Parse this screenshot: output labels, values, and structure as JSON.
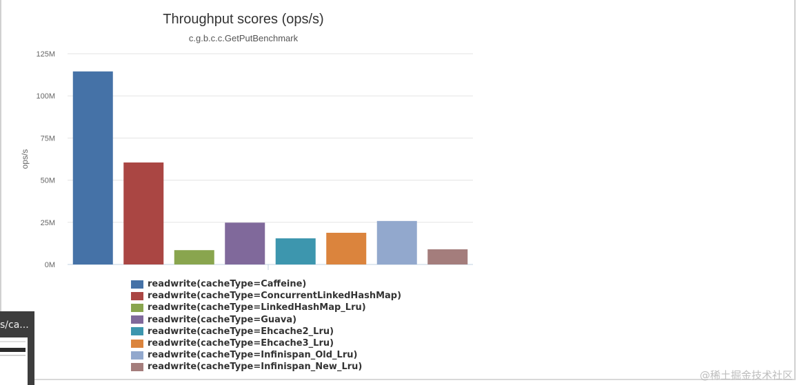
{
  "chart_data": {
    "type": "bar",
    "title": "Throughput scores (ops/s)",
    "subtitle": "c.g.b.c.c.GetPutBenchmark",
    "xlabel": "",
    "ylabel": "ops/s",
    "ylim": [
      0,
      125000000
    ],
    "yticks": [
      {
        "value": 0,
        "label": "0M"
      },
      {
        "value": 25000000,
        "label": "25M"
      },
      {
        "value": 50000000,
        "label": "50M"
      },
      {
        "value": 75000000,
        "label": "75M"
      },
      {
        "value": 100000000,
        "label": "100M"
      },
      {
        "value": 125000000,
        "label": "125M"
      }
    ],
    "grid": true,
    "legend_position": "bottom",
    "series": [
      {
        "name": "readwrite(cacheType=Caffeine)",
        "value": 114500000,
        "color": "#4572a7"
      },
      {
        "name": "readwrite(cacheType=ConcurrentLinkedHashMap)",
        "value": 60500000,
        "color": "#aa4643"
      },
      {
        "name": "readwrite(cacheType=LinkedHashMap_Lru)",
        "value": 8500000,
        "color": "#89a54e"
      },
      {
        "name": "readwrite(cacheType=Guava)",
        "value": 24800000,
        "color": "#80699b"
      },
      {
        "name": "readwrite(cacheType=Ehcache2_Lru)",
        "value": 15500000,
        "color": "#3d96ae"
      },
      {
        "name": "readwrite(cacheType=Ehcache3_Lru)",
        "value": 18800000,
        "color": "#db843d"
      },
      {
        "name": "readwrite(cacheType=Infinispan_Old_Lru)",
        "value": 25800000,
        "color": "#92a8cd"
      },
      {
        "name": "readwrite(cacheType=Infinispan_New_Lru)",
        "value": 9000000,
        "color": "#a47d7c"
      }
    ]
  },
  "thumbnail": {
    "title": "s/ca..."
  },
  "watermark": "@稀土掘金技术社区"
}
